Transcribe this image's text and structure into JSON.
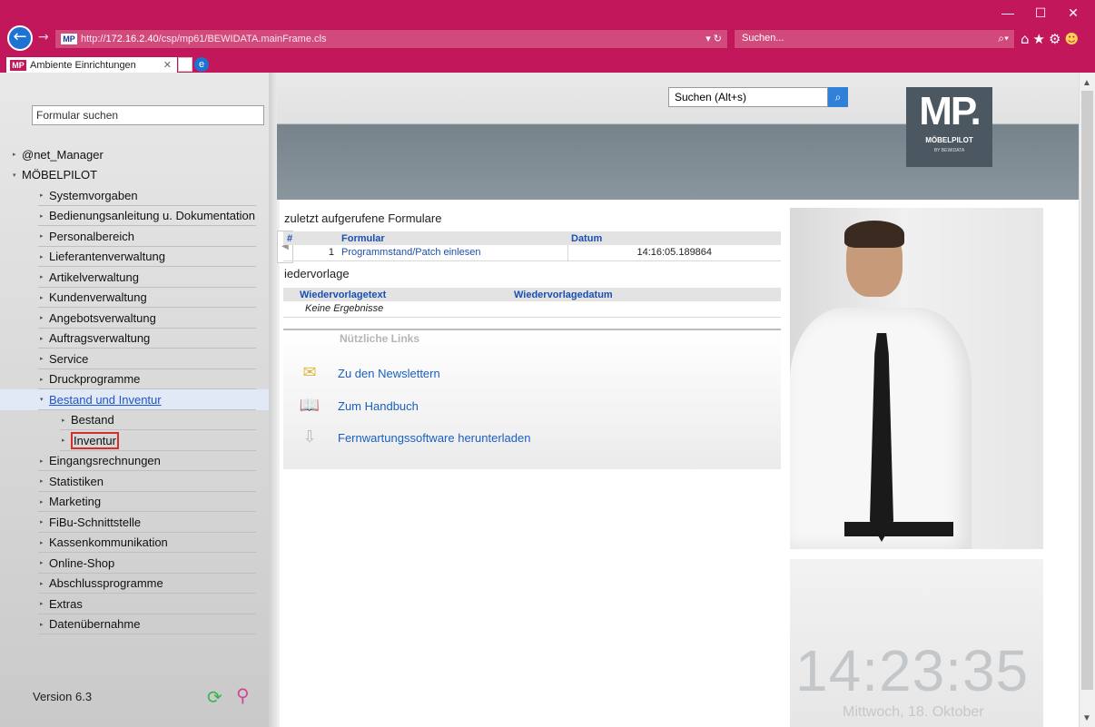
{
  "browser": {
    "url_scheme": "http://",
    "url_host": "172.16.2.40",
    "url_path": "/csp/mp61/BEWIDATA.mainFrame.cls",
    "search_placeholder": "Suchen...",
    "tab_title": "Ambiente Einrichtungen",
    "favicon_text": "MP",
    "window_min": "—",
    "window_max": "☐",
    "window_close": "✕"
  },
  "sidebar": {
    "search_value": "Formular suchen",
    "items": [
      {
        "label": "@net_Manager",
        "level": 0,
        "expanded": false
      },
      {
        "label": "MÖBELPILOT",
        "level": 0,
        "expanded": true
      },
      {
        "label": "Systemvorgaben",
        "level": 1
      },
      {
        "label": "Bedienungsanleitung u. Dokumentation",
        "level": 1
      },
      {
        "label": "Personalbereich",
        "level": 1
      },
      {
        "label": "Lieferantenverwaltung",
        "level": 1
      },
      {
        "label": "Artikelverwaltung",
        "level": 1
      },
      {
        "label": "Kundenverwaltung",
        "level": 1
      },
      {
        "label": "Angebotsverwaltung",
        "level": 1
      },
      {
        "label": "Auftragsverwaltung",
        "level": 1
      },
      {
        "label": "Service",
        "level": 1
      },
      {
        "label": "Druckprogramme",
        "level": 1
      },
      {
        "label": "Bestand und Inventur",
        "level": 1,
        "active": true
      },
      {
        "label": "Bestand",
        "level": 2
      },
      {
        "label": "Inventur",
        "level": 2,
        "highlighted": true
      },
      {
        "label": "Eingangsrechnungen",
        "level": 1
      },
      {
        "label": "Statistiken",
        "level": 1
      },
      {
        "label": "Marketing",
        "level": 1
      },
      {
        "label": "FiBu-Schnittstelle",
        "level": 1
      },
      {
        "label": "Kassenkommunikation",
        "level": 1
      },
      {
        "label": "Online-Shop",
        "level": 1
      },
      {
        "label": "Abschlussprogramme",
        "level": 1
      },
      {
        "label": "Extras",
        "level": 1
      },
      {
        "label": "Datenübernahme",
        "level": 1
      }
    ],
    "version": "Version 6.3"
  },
  "header": {
    "search_value": "Suchen (Alt+s)",
    "logo_mp": "MP.",
    "logo_name": "MÖBELPILOT",
    "logo_by": "BY BEWIDATA"
  },
  "recent_forms": {
    "title": "zuletzt aufgerufene Formulare",
    "columns": [
      "#",
      "Formular",
      "Datum"
    ],
    "rows": [
      {
        "num": "1",
        "form": "Programmstand/Patch einlesen",
        "date": "14:16:05.189864"
      }
    ]
  },
  "resubmission": {
    "title": "iedervorlage",
    "columns": [
      "Wiedervorlagetext",
      "Wiedervorlagedatum"
    ],
    "empty": "Keine Ergebnisse"
  },
  "useful_links": {
    "title": "Nützliche Links",
    "items": [
      {
        "label": "Zu den Newslettern",
        "icon": "newsletter-icon"
      },
      {
        "label": "Zum Handbuch",
        "icon": "manual-icon"
      },
      {
        "label": "Fernwartungssoftware herunterladen",
        "icon": "download-icon"
      }
    ]
  },
  "clock": {
    "time": "14:23:35",
    "date": "Mittwoch, 18. Oktober"
  },
  "colors": {
    "chrome": "#c2185b",
    "link": "#1a4fb0",
    "highlight_box": "#d32f2f"
  }
}
